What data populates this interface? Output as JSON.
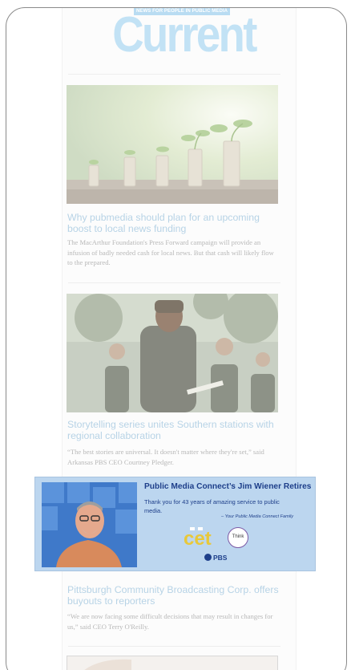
{
  "masthead": {
    "tagline": "NEWS FOR PEOPLE IN PUBLIC MEDIA",
    "logo_text": "Current"
  },
  "stories": [
    {
      "title": "Why pubmedia should plan for an upcoming boost to local news funding",
      "blurb": "The MacArthur Foundation's Press Forward campaign will provide an infusion of badly needed cash for local news. But that cash will likely flow to the prepared."
    },
    {
      "title": "Storytelling series unites Southern stations with regional collaboration",
      "blurb": "“The best stories are universal. It doesn't matter where they're set,” said Arkansas PBS CEO Courtney Pledger."
    },
    {
      "title": "Pittsburgh Community Broadcasting Corp. offers buyouts to reporters",
      "blurb": "“We are now facing some difficult decisions that may result in changes for us,” said CEO Terry O'Reilly."
    }
  ],
  "ad": {
    "headline": "Public Media Connect’s Jim Wiener Retires",
    "body": "Thank you for 43 years of amazing service to public media.",
    "signature": "– Your Public Media Connect Family",
    "cet_logo": "cet",
    "think_logo": "Think",
    "pbs_logo": "PBS"
  },
  "colors": {
    "logo": "#c2e2f5",
    "headline_link": "#b7d3e6",
    "ad_background": "#bcd6ef",
    "ad_text": "#1e3f8a"
  }
}
